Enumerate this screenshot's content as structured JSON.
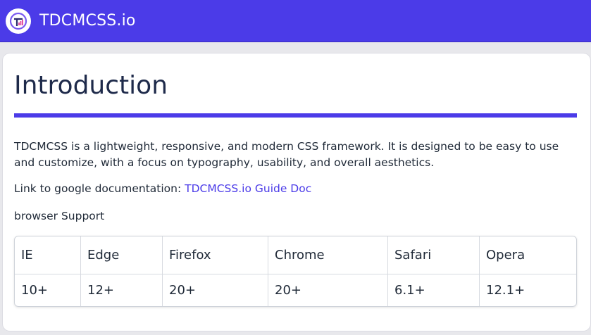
{
  "header": {
    "brand": "TDCMCSS.io",
    "logo_icon": "tdcmcss-logo-icon",
    "accent_color": "#4b3be8"
  },
  "main": {
    "title": "Introduction",
    "description": "TDCMCSS is a lightweight, responsive, and modern CSS framework. It is designed to be easy to use and customize, with a focus on typography, usability, and overall aesthetics.",
    "link_prefix": "Link to google documentation: ",
    "link_text": "TDCMCSS.io Guide Doc",
    "support_label": "browser Support"
  },
  "browser_table": {
    "headers": [
      "IE",
      "Edge",
      "Firefox",
      "Chrome",
      "Safari",
      "Opera"
    ],
    "values": [
      "10+",
      "12+",
      "20+",
      "20+",
      "6.1+",
      "12.1+"
    ]
  }
}
